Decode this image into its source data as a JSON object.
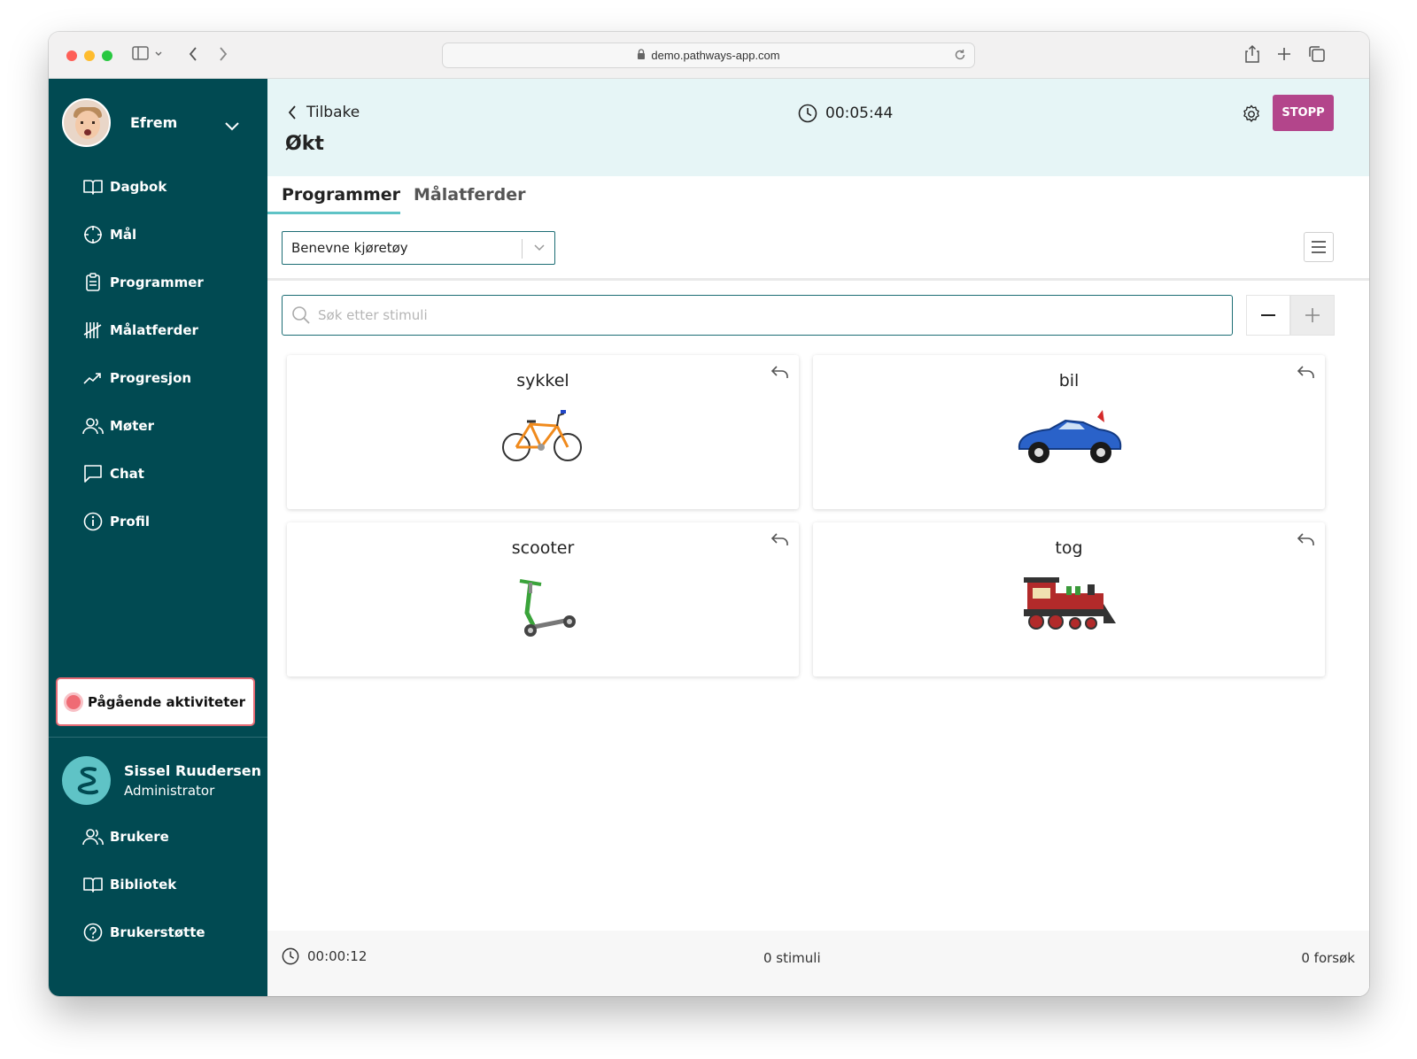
{
  "browser": {
    "url": "demo.pathways-app.com"
  },
  "sidebar": {
    "user_name": "Efrem",
    "items": [
      {
        "label": "Dagbok",
        "icon": "book-icon"
      },
      {
        "label": "Mål",
        "icon": "target-icon"
      },
      {
        "label": "Programmer",
        "icon": "clipboard-icon"
      },
      {
        "label": "Målatferder",
        "icon": "tally-icon"
      },
      {
        "label": "Progresjon",
        "icon": "trend-icon"
      },
      {
        "label": "Møter",
        "icon": "users-icon"
      },
      {
        "label": "Chat",
        "icon": "chat-icon"
      },
      {
        "label": "Profil",
        "icon": "info-icon"
      }
    ],
    "activity_button": "Pågående aktiviteter",
    "admin": {
      "name": "Sissel Ruudersen",
      "role": "Administrator"
    },
    "items2": [
      {
        "label": "Brukere",
        "icon": "users-icon"
      },
      {
        "label": "Bibliotek",
        "icon": "book-icon"
      },
      {
        "label": "Brukerstøtte",
        "icon": "help-icon"
      }
    ]
  },
  "header": {
    "back_label": "Tilbake",
    "title": "Økt",
    "timer": "00:05:44",
    "stop_label": "STOPP"
  },
  "tabs": [
    {
      "label": "Programmer",
      "active": true
    },
    {
      "label": "Målatferder",
      "active": false
    }
  ],
  "program_select": {
    "value": "Benevne kjøretøy"
  },
  "search": {
    "placeholder": "Søk etter stimuli",
    "value": ""
  },
  "stimuli": [
    {
      "label": "sykkel",
      "image": "bicycle"
    },
    {
      "label": "bil",
      "image": "car"
    },
    {
      "label": "scooter",
      "image": "scooter"
    },
    {
      "label": "tog",
      "image": "train"
    }
  ],
  "footer": {
    "time": "00:00:12",
    "stimuli_count": "0 stimuli",
    "attempts": "0 forsøk"
  },
  "colors": {
    "sidebar": "#014a52",
    "header": "#e6f5f6",
    "accent": "#5fc3c6",
    "stop": "#b3458b",
    "recording": "#ef6b74"
  }
}
